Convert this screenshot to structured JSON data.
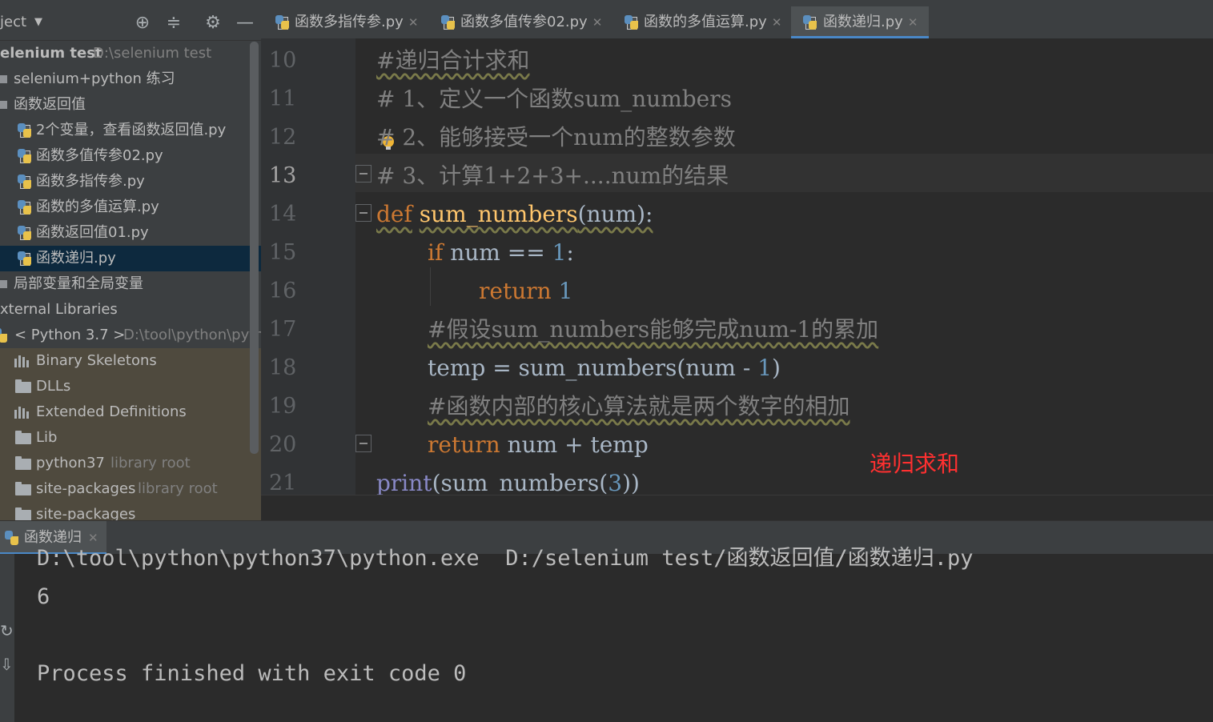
{
  "project_panel": {
    "title": "ject",
    "toolbar_icons": [
      "crosshair-icon",
      "collapse-icon",
      "gear-icon",
      "minimize-icon"
    ],
    "tree": [
      {
        "label": "elenium test",
        "sub": "D:\\selenium test",
        "bold": true
      },
      {
        "label": "selenium+python 练习",
        "icon": "folder"
      },
      {
        "label": "函数返回值",
        "icon": "folder"
      },
      {
        "label": "2个变量，查看函数返回值.py",
        "icon": "python-file"
      },
      {
        "label": "函数多值传参02.py",
        "icon": "python-file"
      },
      {
        "label": "函数多指传参.py",
        "icon": "python-file"
      },
      {
        "label": "函数的多值运算.py",
        "icon": "python-file"
      },
      {
        "label": "函数返回值01.py",
        "icon": "python-file"
      },
      {
        "label": "函数递归.py",
        "icon": "python-file",
        "selected": true
      },
      {
        "label": "局部变量和全局变量",
        "icon": "folder"
      },
      {
        "label": "xternal Libraries"
      },
      {
        "label": "< Python 3.7 >",
        "sub": "D:\\tool\\python\\pyth"
      },
      {
        "label": "Binary Skeletons",
        "icon": "library"
      },
      {
        "label": "DLLs",
        "icon": "folder"
      },
      {
        "label": "Extended Definitions",
        "icon": "library"
      },
      {
        "label": "Lib",
        "icon": "folder"
      },
      {
        "label": "python37",
        "sub": "library root",
        "icon": "folder"
      },
      {
        "label": "site-packages",
        "sub": "library root",
        "icon": "folder"
      },
      {
        "label": "site-packages",
        "icon": "folder"
      }
    ]
  },
  "editor": {
    "tabs": [
      {
        "label": "函数多指传参.py",
        "active": false
      },
      {
        "label": "函数多值传参02.py",
        "active": false
      },
      {
        "label": "函数的多值运算.py",
        "active": false
      },
      {
        "label": "函数递归.py",
        "active": true
      }
    ],
    "current_line": 13,
    "line_numbers": [
      "10",
      "11",
      "12",
      "13",
      "14",
      "15",
      "16",
      "17",
      "18",
      "19",
      "20",
      "21"
    ],
    "code": {
      "l10": "#递归合计求和",
      "l11": "# 1、定义一个函数sum_numbers",
      "l12_a": "#",
      "l12_b": " 2、能够接受一个num的整数参数",
      "l13": "# 3、计算1+2+3+....num的结果",
      "l14_def": "def",
      "l14_name": "sum_numbers",
      "l14_rest": "(num):",
      "l15_if": "if",
      "l15_mid": " num == ",
      "l15_num": "1",
      "l15_end": ":",
      "l16_ret": "return",
      "l16_num": "1",
      "l17": "#假设sum_numbers能够完成num-1的累加",
      "l18_a": "temp = sum_numbers(num - ",
      "l18_num": "1",
      "l18_end": ")",
      "l19": "#函数内部的核心算法就是两个数字的相加",
      "l20_ret": "return",
      "l20_rest": " num + temp",
      "l21_print": "print",
      "l21_a": "(sum_numbers(",
      "l21_num": "3",
      "l21_end": "))"
    },
    "annotation": "递归求和"
  },
  "run_panel": {
    "tab_label": "函数递归",
    "output": [
      "D:\\tool\\python\\python37\\python.exe  D:/selenium test/函数返回值/函数递归.py",
      "6",
      "",
      "Process finished with exit code 0"
    ]
  },
  "colors": {
    "background": "#2b2b2b",
    "panel": "#3c3f41",
    "keyword": "#cc7832",
    "function": "#ffc66d",
    "number": "#6897bb",
    "comment": "#808080",
    "selection": "#0d293e",
    "annotation": "#ff3030"
  }
}
